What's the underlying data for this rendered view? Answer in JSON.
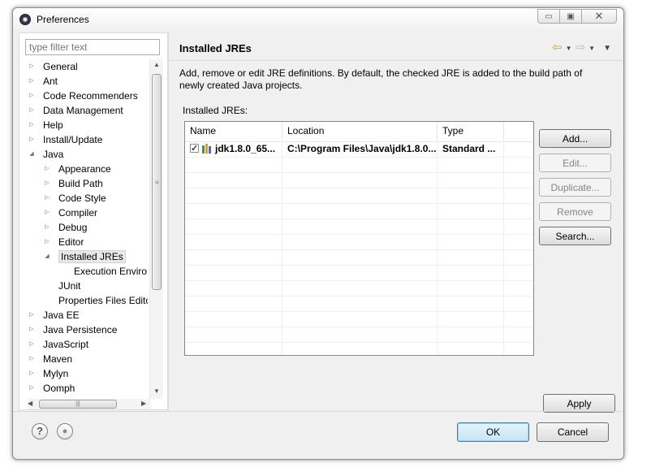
{
  "window": {
    "title": "Preferences",
    "icon": "eclipse-icon",
    "controls": [
      "minimize-icon",
      "restore-icon",
      "close-icon"
    ]
  },
  "left": {
    "filter_placeholder": "type filter text",
    "tree": [
      {
        "label": "General",
        "level": 0,
        "expander": "collapsed"
      },
      {
        "label": "Ant",
        "level": 0,
        "expander": "collapsed"
      },
      {
        "label": "Code Recommenders",
        "level": 0,
        "expander": "collapsed"
      },
      {
        "label": "Data Management",
        "level": 0,
        "expander": "collapsed"
      },
      {
        "label": "Help",
        "level": 0,
        "expander": "collapsed"
      },
      {
        "label": "Install/Update",
        "level": 0,
        "expander": "collapsed"
      },
      {
        "label": "Java",
        "level": 0,
        "expander": "expanded"
      },
      {
        "label": "Appearance",
        "level": 1,
        "expander": "collapsed"
      },
      {
        "label": "Build Path",
        "level": 1,
        "expander": "collapsed"
      },
      {
        "label": "Code Style",
        "level": 1,
        "expander": "collapsed"
      },
      {
        "label": "Compiler",
        "level": 1,
        "expander": "collapsed"
      },
      {
        "label": "Debug",
        "level": 1,
        "expander": "collapsed"
      },
      {
        "label": "Editor",
        "level": 1,
        "expander": "collapsed"
      },
      {
        "label": "Installed JREs",
        "level": 1,
        "expander": "expanded",
        "selected": true
      },
      {
        "label": "Execution Enviro",
        "level": 2,
        "expander": "none"
      },
      {
        "label": "JUnit",
        "level": 1,
        "expander": "none"
      },
      {
        "label": "Properties Files Edito",
        "level": 1,
        "expander": "none"
      },
      {
        "label": "Java EE",
        "level": 0,
        "expander": "collapsed"
      },
      {
        "label": "Java Persistence",
        "level": 0,
        "expander": "collapsed"
      },
      {
        "label": "JavaScript",
        "level": 0,
        "expander": "collapsed"
      },
      {
        "label": "Maven",
        "level": 0,
        "expander": "collapsed"
      },
      {
        "label": "Mylyn",
        "level": 0,
        "expander": "collapsed"
      },
      {
        "label": "Oomph",
        "level": 0,
        "expander": "collapsed"
      }
    ]
  },
  "page": {
    "title": "Installed JREs",
    "description": "Add, remove or edit JRE definitions. By default, the checked JRE is added to the build path of newly created Java projects.",
    "table_label": "Installed JREs:",
    "columns": [
      "Name",
      "Location",
      "Type"
    ],
    "rows": [
      {
        "checked": true,
        "name": "jdk1.8.0_65...",
        "location": "C:\\Program Files\\Java\\jdk1.8.0...",
        "type": "Standard ..."
      }
    ],
    "buttons": {
      "add": "Add...",
      "edit": "Edit...",
      "duplicate": "Duplicate...",
      "remove": "Remove",
      "search": "Search..."
    },
    "apply": "Apply"
  },
  "footer": {
    "ok": "OK",
    "cancel": "Cancel",
    "help_glyph": "?",
    "record_glyph": "●"
  },
  "colors": {
    "window_bg": "#f0f0f0",
    "default_button": "#3c7fb1",
    "nav_back_arrow": "#d9a21b"
  }
}
